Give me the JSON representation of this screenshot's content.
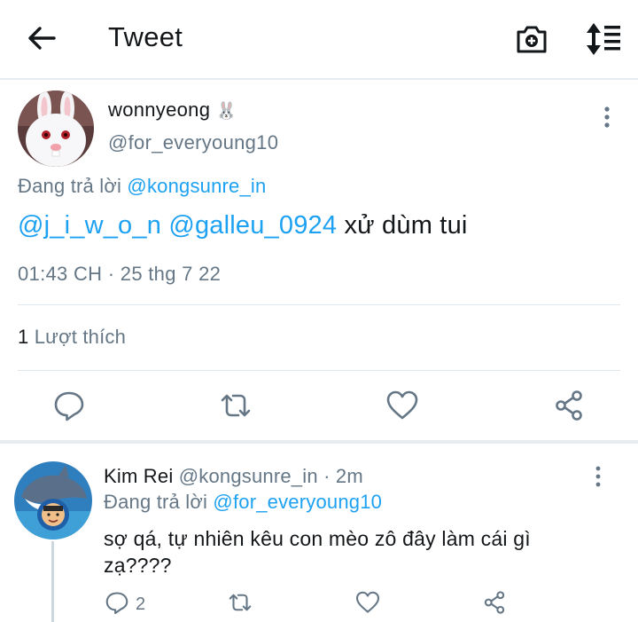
{
  "header": {
    "title": "Tweet"
  },
  "tweet": {
    "display_name": "wonnyeong",
    "name_emoji": "🐰",
    "handle": "@for_everyoung10",
    "reply_prefix": "Đang trả lời",
    "reply_to": "@kongsunre_in",
    "mention_1": "@j_i_w_o_n",
    "mention_2": "@galleu_0924",
    "text": "xử dùm tui",
    "timestamp": "01:43 CH · 25 thg 7 22",
    "like_count": "1",
    "like_label": "Lượt thích"
  },
  "reply": {
    "display_name": "Kim Rei",
    "handle": "@kongsunre_in",
    "time": "· 2m",
    "reply_prefix": "Đang trả lời",
    "reply_to": "@for_everyoung10",
    "text": "sợ qá, tự nhiên kêu con mèo zô đây làm cái gì zạ????",
    "reply_count": "2"
  },
  "colors": {
    "link": "#1da1f2",
    "muted": "#657786",
    "separator": "#e1e8ed"
  }
}
